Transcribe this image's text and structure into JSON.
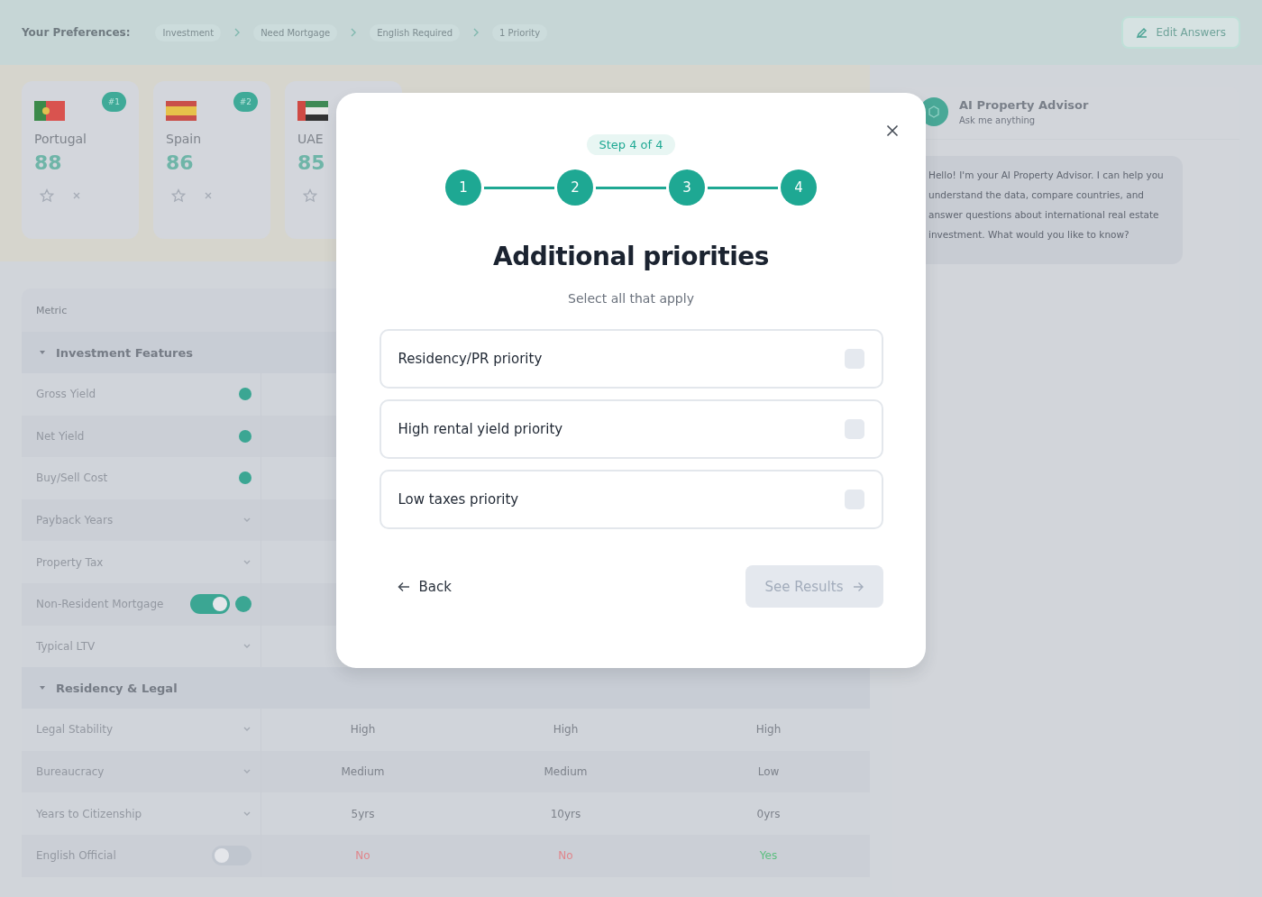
{
  "top_bar": {
    "label": "Your Preferences:",
    "chips": [
      "Investment",
      "Need Mortgage",
      "English Required",
      "1 Priority"
    ],
    "edit_button": "Edit Answers"
  },
  "country_cards": [
    {
      "name": "Portugal",
      "score": "88",
      "rank": "#1",
      "kind": "portugal"
    },
    {
      "name": "Spain",
      "score": "86",
      "rank": "#2",
      "kind": "spain"
    },
    {
      "name": "UAE",
      "score": "85",
      "kind": "uae"
    }
  ],
  "table": {
    "header": "Metric",
    "sections": [
      {
        "title": "Investment Features",
        "expanded": true,
        "rows": [
          {
            "label": "Gross Yield",
            "kind": "dot",
            "values": []
          },
          {
            "label": "Net Yield",
            "kind": "dot",
            "values": []
          },
          {
            "label": "Buy/Sell Cost",
            "kind": "dot",
            "values": []
          },
          {
            "label": "Payback Years",
            "kind": "chevron",
            "values": []
          },
          {
            "label": "Property Tax",
            "kind": "chevron",
            "values": []
          },
          {
            "label": "Non-Resident Mortgage",
            "kind": "toggle",
            "on": true,
            "values": []
          },
          {
            "label": "Typical LTV",
            "kind": "chevron",
            "values": []
          }
        ]
      },
      {
        "title": "Residency & Legal",
        "expanded": true,
        "rows": [
          {
            "label": "Legal Stability",
            "kind": "chevron",
            "values": [
              {
                "text": "High"
              },
              {
                "text": "High"
              },
              {
                "text": "High"
              }
            ]
          },
          {
            "label": "Bureaucracy",
            "kind": "chevron",
            "values": [
              {
                "text": "Medium"
              },
              {
                "text": "Medium"
              },
              {
                "text": "Low"
              }
            ]
          },
          {
            "label": "Years to Citizenship",
            "kind": "chevron",
            "values": [
              {
                "text": "5yrs"
              },
              {
                "text": "10yrs"
              },
              {
                "text": "0yrs"
              }
            ]
          },
          {
            "label": "English Official",
            "kind": "toggle",
            "on": false,
            "values": [
              {
                "text": "No",
                "color": "#e0868c"
              },
              {
                "text": "No",
                "color": "#e0868c"
              },
              {
                "text": "Yes",
                "color": "#5bbf7f"
              }
            ]
          }
        ]
      }
    ]
  },
  "chat": {
    "title": "AI Property Advisor",
    "subtitle": "Ask me anything",
    "messages": [
      {
        "text": "Hello! I'm your AI Property Advisor. I can help you understand the data, compare countries, and answer questions about international real estate investment. What would you like to know?"
      }
    ]
  },
  "modal": {
    "step": "Step 4 of 4",
    "steps": [
      {
        "label": "1",
        "done": true
      },
      {
        "label": "2",
        "done": true
      },
      {
        "label": "3",
        "done": true
      },
      {
        "label": "4",
        "done": true
      }
    ],
    "title": "Additional priorities",
    "subtitle": "Select all that apply",
    "options": [
      {
        "label": "Residency/PR priority",
        "checked": false
      },
      {
        "label": "High rental yield priority",
        "checked": false
      },
      {
        "label": "Low taxes priority",
        "checked": false
      }
    ],
    "back": "Back",
    "next": {
      "label": "See Results",
      "disabled": true
    }
  }
}
